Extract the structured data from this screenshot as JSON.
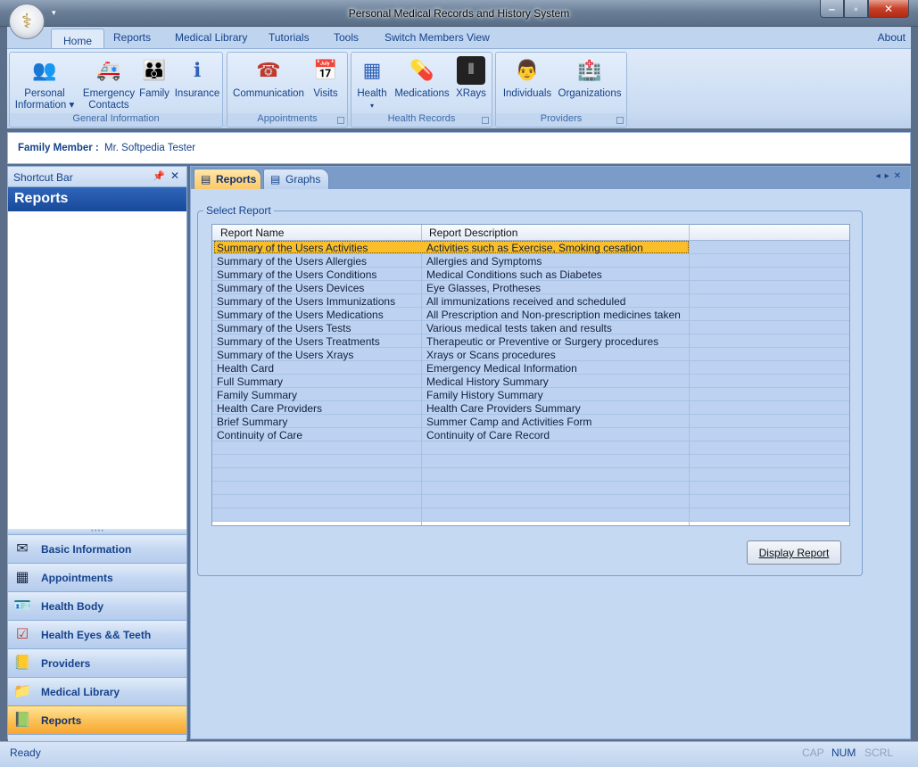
{
  "window": {
    "title": "Personal Medical Records and History System"
  },
  "ribbon": {
    "tabs": [
      "Home",
      "Reports",
      "Medical Library",
      "Tutorials",
      "Tools",
      "Switch Members View"
    ],
    "about": "About",
    "groups": {
      "general": {
        "label": "General  Information",
        "buttons": [
          "Personal",
          "Information",
          "Emergency",
          "Contacts",
          "Family",
          "Insurance"
        ]
      },
      "appointments": {
        "label": "Appointments",
        "buttons": [
          "Communication",
          "Visits"
        ]
      },
      "health_records": {
        "label": "Health Records",
        "buttons": [
          "Health",
          "Medications",
          "XRays"
        ]
      },
      "providers": {
        "label": "Providers",
        "buttons": [
          "Individuals",
          "Organizations"
        ]
      }
    }
  },
  "member": {
    "label": "Family Member :",
    "value": "Mr. Softpedia Tester"
  },
  "shortcut_bar": {
    "header": "Shortcut Bar",
    "title": "Reports",
    "items": [
      "Basic Information",
      "Appointments",
      "Health Body",
      "Health Eyes && Teeth",
      "Providers",
      "Medical Library",
      "Reports"
    ],
    "active_index": 6
  },
  "document": {
    "tabs": [
      "Reports",
      "Graphs"
    ],
    "group_label": "Select Report",
    "columns": [
      "Report Name",
      "Report Description"
    ],
    "rows": [
      {
        "name": "Summary of the Users Activities",
        "desc": "Activities such as Exercise, Smoking cesation"
      },
      {
        "name": "Summary of the Users Allergies",
        "desc": "Allergies and Symptoms"
      },
      {
        "name": "Summary of the Users Conditions",
        "desc": "Medical Conditions such as Diabetes"
      },
      {
        "name": "Summary of the Users Devices",
        "desc": "Eye Glasses, Protheses"
      },
      {
        "name": "Summary of the Users Immunizations",
        "desc": "All immunizations received and scheduled"
      },
      {
        "name": "Summary of the Users Medications",
        "desc": "All Prescription and Non-prescription medicines taken"
      },
      {
        "name": "Summary of the Users Tests",
        "desc": "Various medical tests taken and results"
      },
      {
        "name": "Summary of the Users Treatments",
        "desc": "Therapeutic or Preventive or Surgery procedures"
      },
      {
        "name": "Summary of the Users Xrays",
        "desc": "Xrays or Scans procedures"
      },
      {
        "name": "Health Card",
        "desc": "Emergency Medical Information"
      },
      {
        "name": "Full Summary",
        "desc": "Medical History Summary"
      },
      {
        "name": "Family Summary",
        "desc": "Family History Summary"
      },
      {
        "name": "Health Care Providers",
        "desc": "Health Care Providers Summary"
      },
      {
        "name": "Brief Summary",
        "desc": "Summer Camp and Activities Form"
      },
      {
        "name": "Continuity of Care",
        "desc": "Continuity of Care Record"
      }
    ],
    "selected_index": 0,
    "empty_rows": 6,
    "button": "Display Report"
  },
  "status": {
    "text": "Ready",
    "indicators": [
      "CAP",
      "NUM",
      "SCRL"
    ]
  },
  "colors": {
    "accent": "#15428b",
    "selection": "#f9be2a",
    "active_nav": "#fbc35a"
  }
}
